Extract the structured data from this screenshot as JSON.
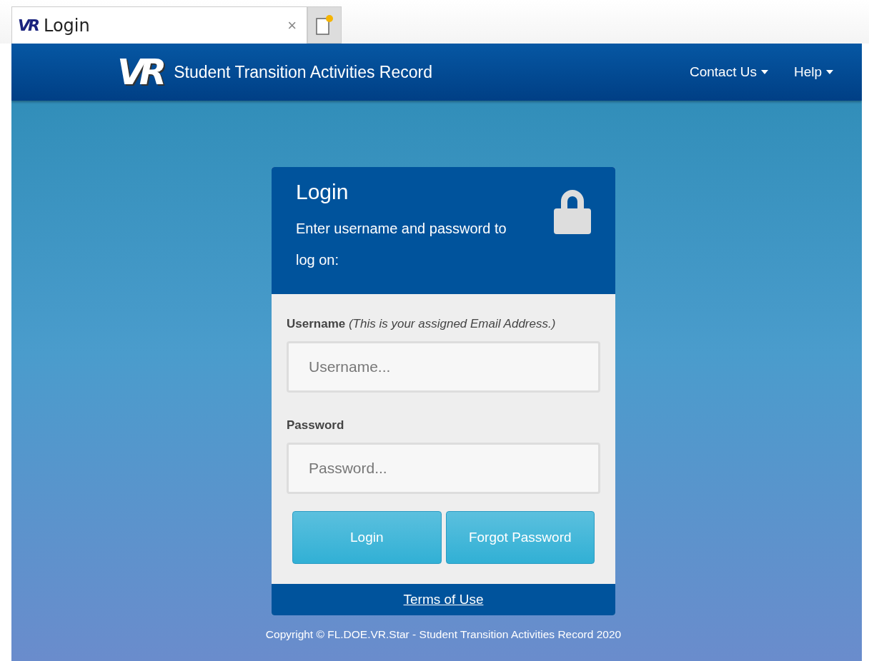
{
  "browser_tab": {
    "favicon_text": "VR",
    "title": "Login",
    "close": "×"
  },
  "navbar": {
    "logo_text": "VR",
    "title": "Student Transition Activities Record",
    "menus": [
      {
        "label": "Contact Us"
      },
      {
        "label": "Help"
      }
    ]
  },
  "login_card": {
    "heading": "Login",
    "subtitle": "Enter username and password to log on:",
    "fields": [
      {
        "label": "**Username** *(This is your assigned Email Address.)*",
        "placeholder": "Username..."
      },
      {
        "label": "**Password**",
        "placeholder": "Password..."
      }
    ],
    "buttons": [
      "Login",
      "Forgot Password"
    ],
    "footer_link": "Terms of Use"
  },
  "copyright": "Copyright © FL.DOE.VR.Star - Student Transition Activities Record 2020"
}
